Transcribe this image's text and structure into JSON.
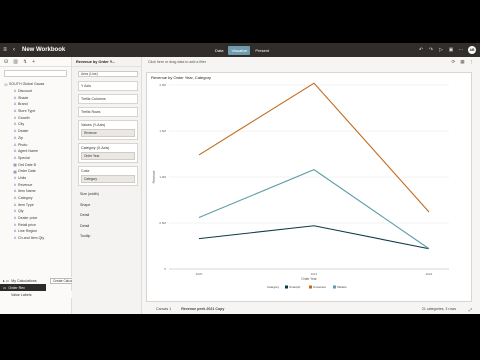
{
  "header": {
    "title": "New Workbook",
    "tabs": [
      {
        "label": "Data",
        "active": false
      },
      {
        "label": "Visualize",
        "active": true
      },
      {
        "label": "Present",
        "active": false
      }
    ],
    "user_initials": "AB"
  },
  "data_panel": {
    "tree": [
      {
        "label": "SOUTH Global Gauss",
        "level": "root",
        "icon": "database-icon"
      },
      {
        "label": "Discount",
        "level": "child",
        "icon": "measure-icon"
      },
      {
        "label": "Shade",
        "level": "child",
        "icon": "attribute-icon"
      },
      {
        "label": "Brand",
        "level": "child",
        "icon": "attribute-icon"
      },
      {
        "label": "Store Type",
        "level": "child",
        "icon": "attribute-icon"
      },
      {
        "label": "Growth",
        "level": "child",
        "icon": "measure-icon"
      },
      {
        "label": "City",
        "level": "child",
        "icon": "attribute-icon"
      },
      {
        "label": "Dealer",
        "level": "child",
        "icon": "attribute-icon"
      },
      {
        "label": "Zip",
        "level": "child",
        "icon": "attribute-icon"
      },
      {
        "label": "Photo",
        "level": "child",
        "icon": "attribute-icon"
      },
      {
        "label": "Agent Name",
        "level": "child",
        "icon": "attribute-icon"
      },
      {
        "label": "Special",
        "level": "child",
        "icon": "attribute-icon"
      },
      {
        "label": "Ord Date B",
        "level": "child",
        "icon": "calendar-icon"
      },
      {
        "label": "Order Date",
        "level": "child",
        "icon": "calendar-icon"
      },
      {
        "label": "Units",
        "level": "child",
        "icon": "measure-icon"
      },
      {
        "label": "Revenue",
        "level": "child",
        "icon": "measure-icon"
      },
      {
        "label": "Item Name",
        "level": "child",
        "icon": "attribute-icon"
      },
      {
        "label": "Category",
        "level": "child",
        "icon": "attribute-icon"
      },
      {
        "label": "Item Type",
        "level": "child",
        "icon": "attribute-icon"
      },
      {
        "label": "Qty",
        "level": "child",
        "icon": "measure-icon"
      },
      {
        "label": "Dealer price",
        "level": "child",
        "icon": "measure-icon"
      },
      {
        "label": "Retail price",
        "level": "child",
        "icon": "measure-icon"
      },
      {
        "label": "Line Region",
        "level": "child",
        "icon": "attribute-icon"
      },
      {
        "label": "Ch and Item Qty",
        "level": "child",
        "icon": "measure-icon"
      }
    ],
    "context": {
      "my_calculations": "My Calculations",
      "tooltip": "Create Calculation...",
      "selected_item": "Order Rev",
      "value_labels": "Value Labels"
    }
  },
  "grammar": {
    "tab_label": "Revenue by Order Y...",
    "viz_type": "Area (Line)",
    "sections": [
      {
        "label": "Y Axis",
        "pill": ""
      },
      {
        "label": "Trellis Columns",
        "pill": ""
      },
      {
        "label": "Trellis Rows",
        "pill": ""
      },
      {
        "label": "Values (Y-Axis)",
        "pill": "Revenue"
      },
      {
        "label": "Category (X-Axis)",
        "pill": "Order Year"
      },
      {
        "label": "Color",
        "pill": "Category"
      }
    ],
    "links": [
      "Size (width)",
      "Shape",
      "Detail",
      "Detail",
      "Tooltip"
    ]
  },
  "canvas": {
    "filter_placeholder": "Click here or drag data to add a filter",
    "viz_title": "Revenue by Order Year, Category",
    "footer_tabs": [
      "Canvas 1",
      "Revenue peek 2021 Copy"
    ],
    "footer_status": "21 categories, 3 rows"
  },
  "chart_data": {
    "type": "line",
    "title": "Revenue by Order Year, Category",
    "x": [
      "2020",
      "2021",
      "2022"
    ],
    "xlabel": "Order Year",
    "ylabel": "Revenue",
    "ylim": [
      0,
      2000000
    ],
    "yticks": [
      "0",
      "0.5M",
      "1.0M",
      "1.5M",
      "2.0M"
    ],
    "legend_title": "Category",
    "legend_position": "bottom",
    "series": [
      {
        "name": "Smartph",
        "color": "#0f3a44",
        "values": [
          330000,
          470000,
          220000
        ]
      },
      {
        "name": "Universal",
        "color": "#c06a1e",
        "values": [
          1240000,
          2020000,
          620000
        ]
      },
      {
        "name": "Tablets",
        "color": "#5a9ea8",
        "values": [
          560000,
          1080000,
          220000
        ]
      }
    ]
  },
  "colors": {
    "header_bg": "#312d2a",
    "active_tab": "#6f9bb0"
  }
}
